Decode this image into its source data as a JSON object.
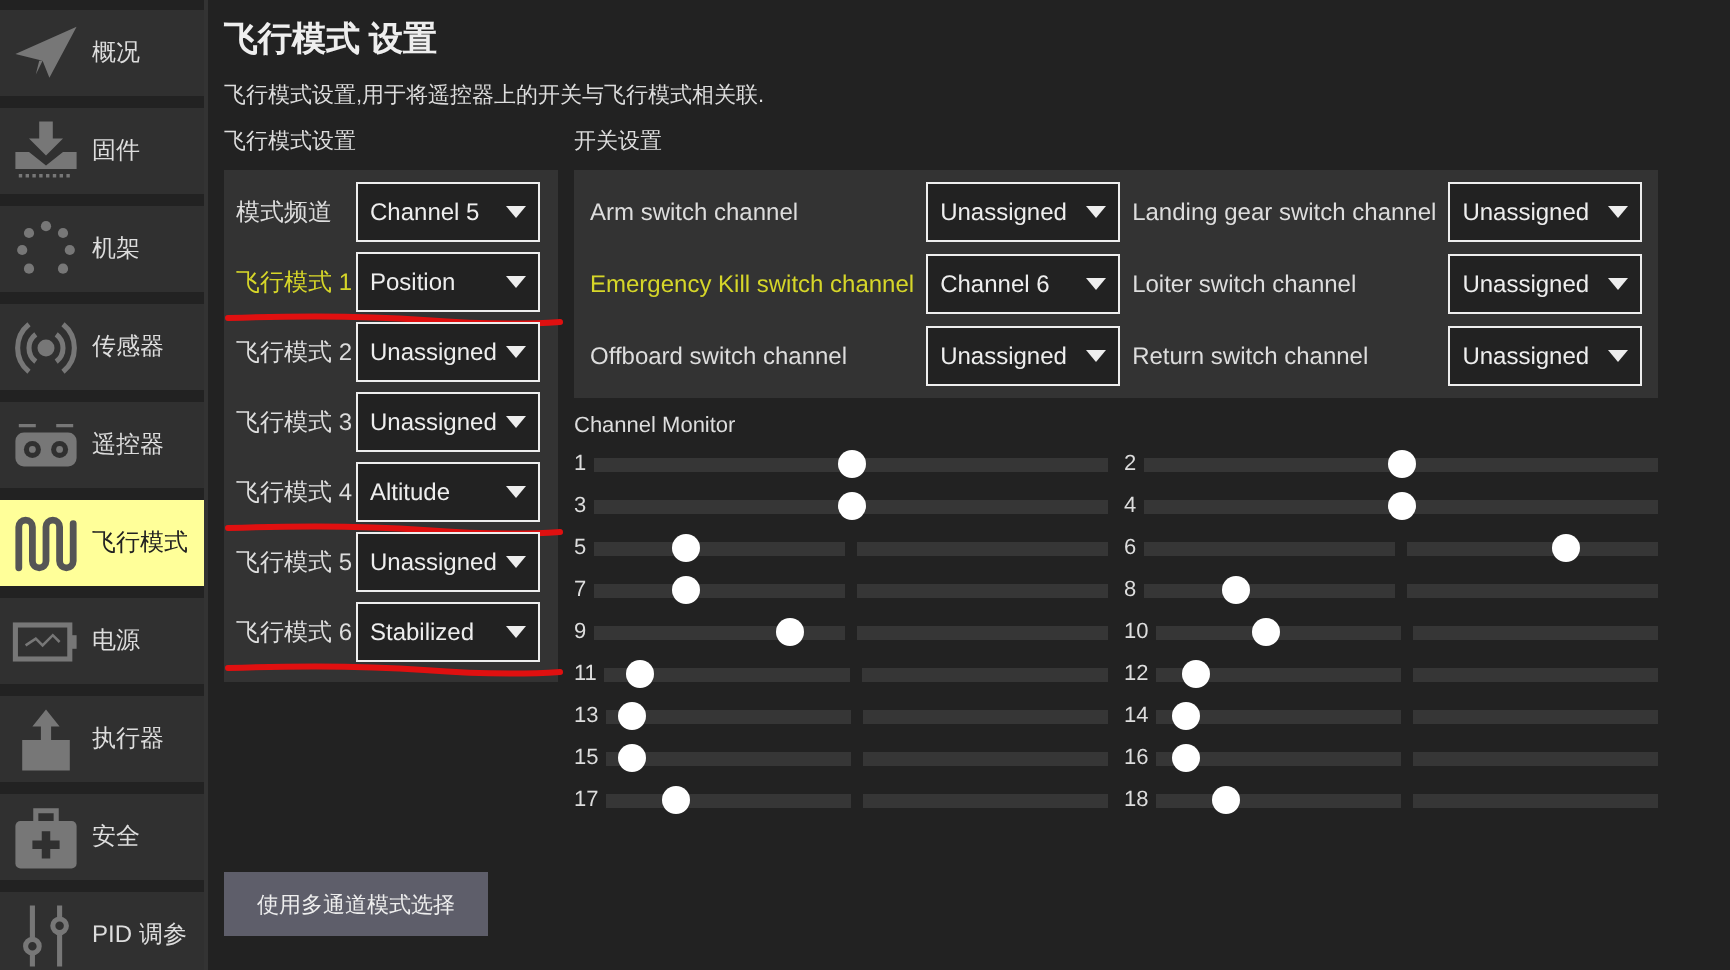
{
  "sidebar": {
    "items": [
      {
        "label": "概况",
        "kind": "plane",
        "selected": false
      },
      {
        "label": "固件",
        "kind": "download",
        "selected": false
      },
      {
        "label": "机架",
        "kind": "dots",
        "selected": false
      },
      {
        "label": "传感器",
        "kind": "radio",
        "selected": false
      },
      {
        "label": "遥控器",
        "kind": "remote",
        "selected": false
      },
      {
        "label": "飞行模式",
        "kind": "wave",
        "selected": true
      },
      {
        "label": "电源",
        "kind": "battery",
        "selected": false
      },
      {
        "label": "执行器",
        "kind": "actuator",
        "selected": false
      },
      {
        "label": "安全",
        "kind": "medkit",
        "selected": false
      },
      {
        "label": "PID 调参",
        "kind": "sliders",
        "selected": false
      }
    ]
  },
  "page": {
    "title": "飞行模式 设置",
    "description": "飞行模式设置,用于将遥控器上的开关与飞行模式相关联."
  },
  "flight_modes": {
    "heading": "飞行模式设置",
    "rows": [
      {
        "label": "模式频道",
        "value": "Channel 5",
        "highlighted": false,
        "underlined": false
      },
      {
        "label": "飞行模式 1",
        "value": "Position",
        "highlighted": true,
        "underlined": true
      },
      {
        "label": "飞行模式 2",
        "value": "Unassigned",
        "highlighted": false,
        "underlined": false
      },
      {
        "label": "飞行模式 3",
        "value": "Unassigned",
        "highlighted": false,
        "underlined": false
      },
      {
        "label": "飞行模式 4",
        "value": "Altitude",
        "highlighted": false,
        "underlined": true
      },
      {
        "label": "飞行模式 5",
        "value": "Unassigned",
        "highlighted": false,
        "underlined": false
      },
      {
        "label": "飞行模式 6",
        "value": "Stabilized",
        "highlighted": false,
        "underlined": true
      }
    ]
  },
  "switches": {
    "heading": "开关设置",
    "items": [
      {
        "label": "Arm switch channel",
        "value": "Unassigned",
        "highlighted": false
      },
      {
        "label": "Landing gear switch channel",
        "value": "Unassigned",
        "highlighted": false
      },
      {
        "label": "Emergency Kill switch channel",
        "value": "Channel 6",
        "highlighted": true
      },
      {
        "label": "Loiter switch channel",
        "value": "Unassigned",
        "highlighted": false
      },
      {
        "label": "Offboard switch channel",
        "value": "Unassigned",
        "highlighted": false
      },
      {
        "label": "Return switch channel",
        "value": "Unassigned",
        "highlighted": false
      }
    ]
  },
  "channel_monitor": {
    "heading": "Channel Monitor",
    "channels": [
      {
        "label": "1",
        "level": 0.5
      },
      {
        "label": "2",
        "level": 0.5
      },
      {
        "label": "3",
        "level": 0.5
      },
      {
        "label": "4",
        "level": 0.5
      },
      {
        "label": "5",
        "level": 0.18
      },
      {
        "label": "6",
        "level": 0.82
      },
      {
        "label": "7",
        "level": 0.18
      },
      {
        "label": "8",
        "level": 0.18
      },
      {
        "label": "9",
        "level": 0.38
      },
      {
        "label": "10",
        "level": 0.22
      },
      {
        "label": "11",
        "level": 0.07
      },
      {
        "label": "12",
        "level": 0.08
      },
      {
        "label": "13",
        "level": 0.05
      },
      {
        "label": "14",
        "level": 0.06
      },
      {
        "label": "15",
        "level": 0.05
      },
      {
        "label": "16",
        "level": 0.06
      },
      {
        "label": "17",
        "level": 0.14
      },
      {
        "label": "18",
        "level": 0.14
      }
    ]
  },
  "multi_channel_button": "使用多通道模式选择"
}
